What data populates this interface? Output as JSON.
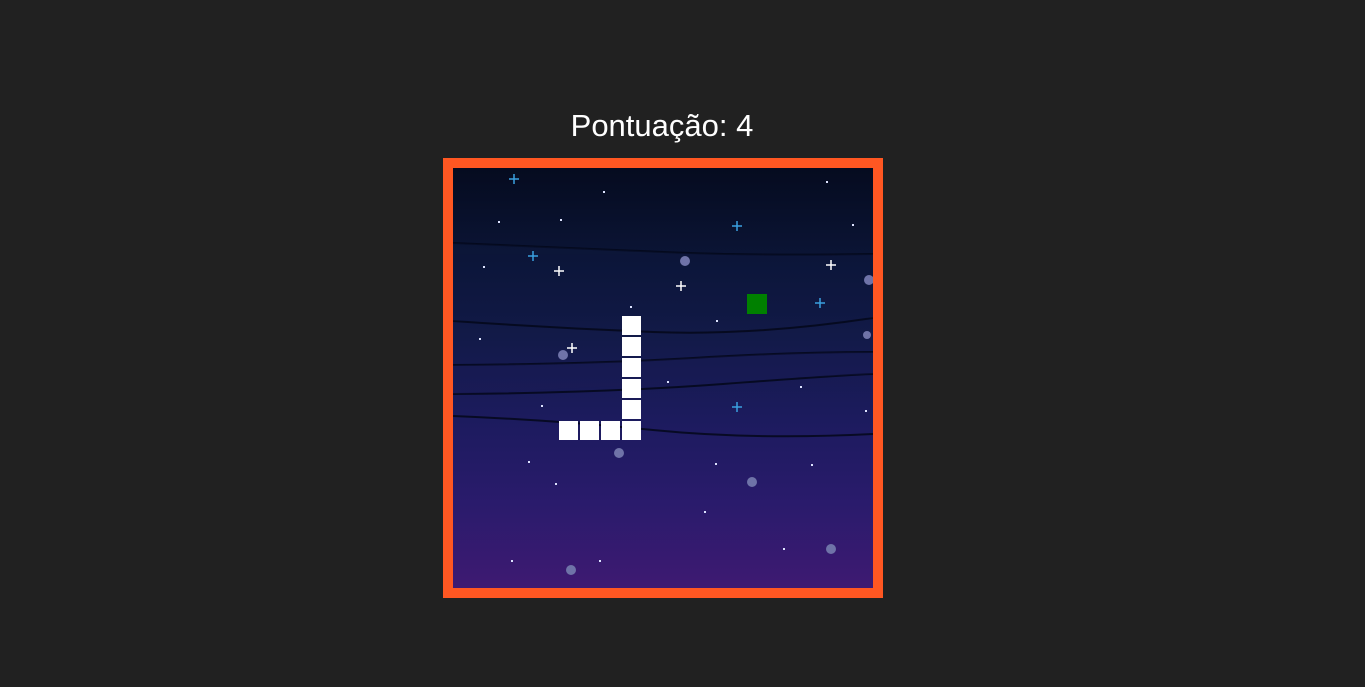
{
  "score": {
    "text": "Pontuação: 4"
  },
  "game": {
    "grid_size": 20,
    "snake": [
      [
        8,
        7
      ],
      [
        8,
        8
      ],
      [
        8,
        9
      ],
      [
        8,
        10
      ],
      [
        8,
        11
      ],
      [
        7,
        12
      ],
      [
        6,
        12
      ],
      [
        5,
        12
      ],
      [
        8,
        12
      ]
    ],
    "food": [
      14,
      6
    ],
    "colors": {
      "border": "#ff5722",
      "snake": "#ffffff",
      "food": "#008000",
      "page_background": "#212121"
    }
  }
}
